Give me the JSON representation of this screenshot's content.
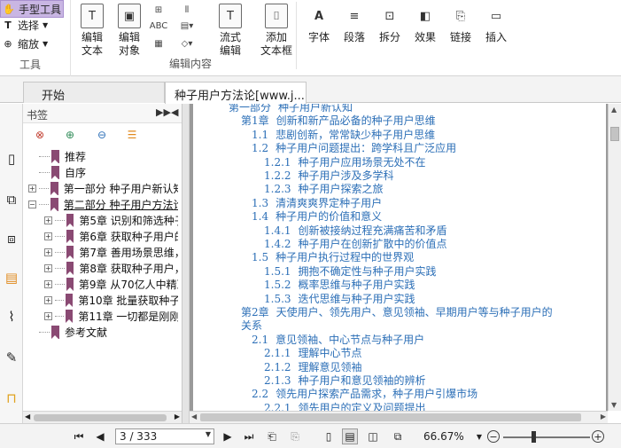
{
  "toolbar": {
    "hand_tool": "手型工具",
    "select": "选择",
    "zoom": "缩放",
    "tools_group": "工具",
    "edit_text": "编辑\n文本",
    "edit_object": "编辑\n对象",
    "flow_edit": "流式\n编辑",
    "add_textbox": "添加\n文本框",
    "edit_content_group": "编辑内容",
    "font": "字体",
    "paragraph": "段落",
    "split": "拆分",
    "effect": "效果",
    "link": "链接",
    "insert": "插入"
  },
  "tabs": [
    {
      "label": "开始"
    },
    {
      "label": "种子用户方法论[www.j..."
    }
  ],
  "bookmarks": {
    "title": "书签",
    "items": [
      {
        "label": "推荐",
        "level": 0,
        "toggle": ""
      },
      {
        "label": "自序",
        "level": 0,
        "toggle": ""
      },
      {
        "label": "第一部分 种子用户新认知",
        "level": 0,
        "toggle": "+"
      },
      {
        "label": "第二部分 种子用户方法论",
        "level": 0,
        "toggle": "−",
        "selected": true
      },
      {
        "label": "第5章 识别和筛选种子",
        "level": 1,
        "toggle": "+"
      },
      {
        "label": "第6章 获取种子用户的",
        "level": 1,
        "toggle": "+"
      },
      {
        "label": "第7章 善用场景思维，",
        "level": 1,
        "toggle": "+"
      },
      {
        "label": "第8章 获取种子用户，",
        "level": 1,
        "toggle": "+"
      },
      {
        "label": "第9章 从70亿人中精准",
        "level": 1,
        "toggle": "+"
      },
      {
        "label": "第10章 批量获取种子用",
        "level": 1,
        "toggle": "+"
      },
      {
        "label": "第11章 一切都是刚刚开",
        "level": 1,
        "toggle": "+"
      },
      {
        "label": "参考文献",
        "level": 0,
        "toggle": ""
      }
    ]
  },
  "toc": [
    {
      "num": "第一部分",
      "text": "种子用户新认知",
      "indent": 0
    },
    {
      "num": "第1章",
      "text": "创新和新产品必备的种子用户思维",
      "indent": 1
    },
    {
      "num": "1.1",
      "text": "悲剧创新，常常缺少种子用户思维",
      "indent": 2
    },
    {
      "num": "1.2",
      "text": "种子用户问题提出：跨学科且广泛应用",
      "indent": 2
    },
    {
      "num": "1.2.1",
      "text": "种子用户应用场景无处不在",
      "indent": 3
    },
    {
      "num": "1.2.2",
      "text": "种子用户涉及多学科",
      "indent": 3
    },
    {
      "num": "1.2.3",
      "text": "种子用户探索之旅",
      "indent": 3
    },
    {
      "num": "1.3",
      "text": "清清爽爽界定种子用户",
      "indent": 2
    },
    {
      "num": "1.4",
      "text": "种子用户的价值和意义",
      "indent": 2
    },
    {
      "num": "1.4.1",
      "text": "创新被接纳过程充满痛苦和矛盾",
      "indent": 3
    },
    {
      "num": "1.4.2",
      "text": "种子用户在创新扩散中的价值点",
      "indent": 3
    },
    {
      "num": "1.5",
      "text": "种子用户执行过程中的世界观",
      "indent": 2
    },
    {
      "num": "1.5.1",
      "text": "拥抱不确定性与种子用户实践",
      "indent": 3
    },
    {
      "num": "1.5.2",
      "text": "概率思维与种子用户实践",
      "indent": 3
    },
    {
      "num": "1.5.3",
      "text": "迭代思维与种子用户实践",
      "indent": 3
    },
    {
      "num": "第2章",
      "text": "天使用户、领先用户、意见领袖、早期用户等与种子用户的",
      "indent": 1
    },
    {
      "num": "",
      "text": "关系",
      "indent": 1.5
    },
    {
      "num": "2.1",
      "text": "意见领袖、中心节点与种子用户",
      "indent": 2
    },
    {
      "num": "2.1.1",
      "text": "理解中心节点",
      "indent": 3
    },
    {
      "num": "2.1.2",
      "text": "理解意见领袖",
      "indent": 3
    },
    {
      "num": "2.1.3",
      "text": "种子用户和意见领袖的辨析",
      "indent": 3
    },
    {
      "num": "2.2",
      "text": "领先用户探索产品需求，种子用户引爆市场",
      "indent": 2
    },
    {
      "num": "2.2.1",
      "text": "领先用户的定义及问题提出",
      "indent": 3
    }
  ],
  "status": {
    "page": "3 / 333",
    "zoom": "66.67%"
  }
}
